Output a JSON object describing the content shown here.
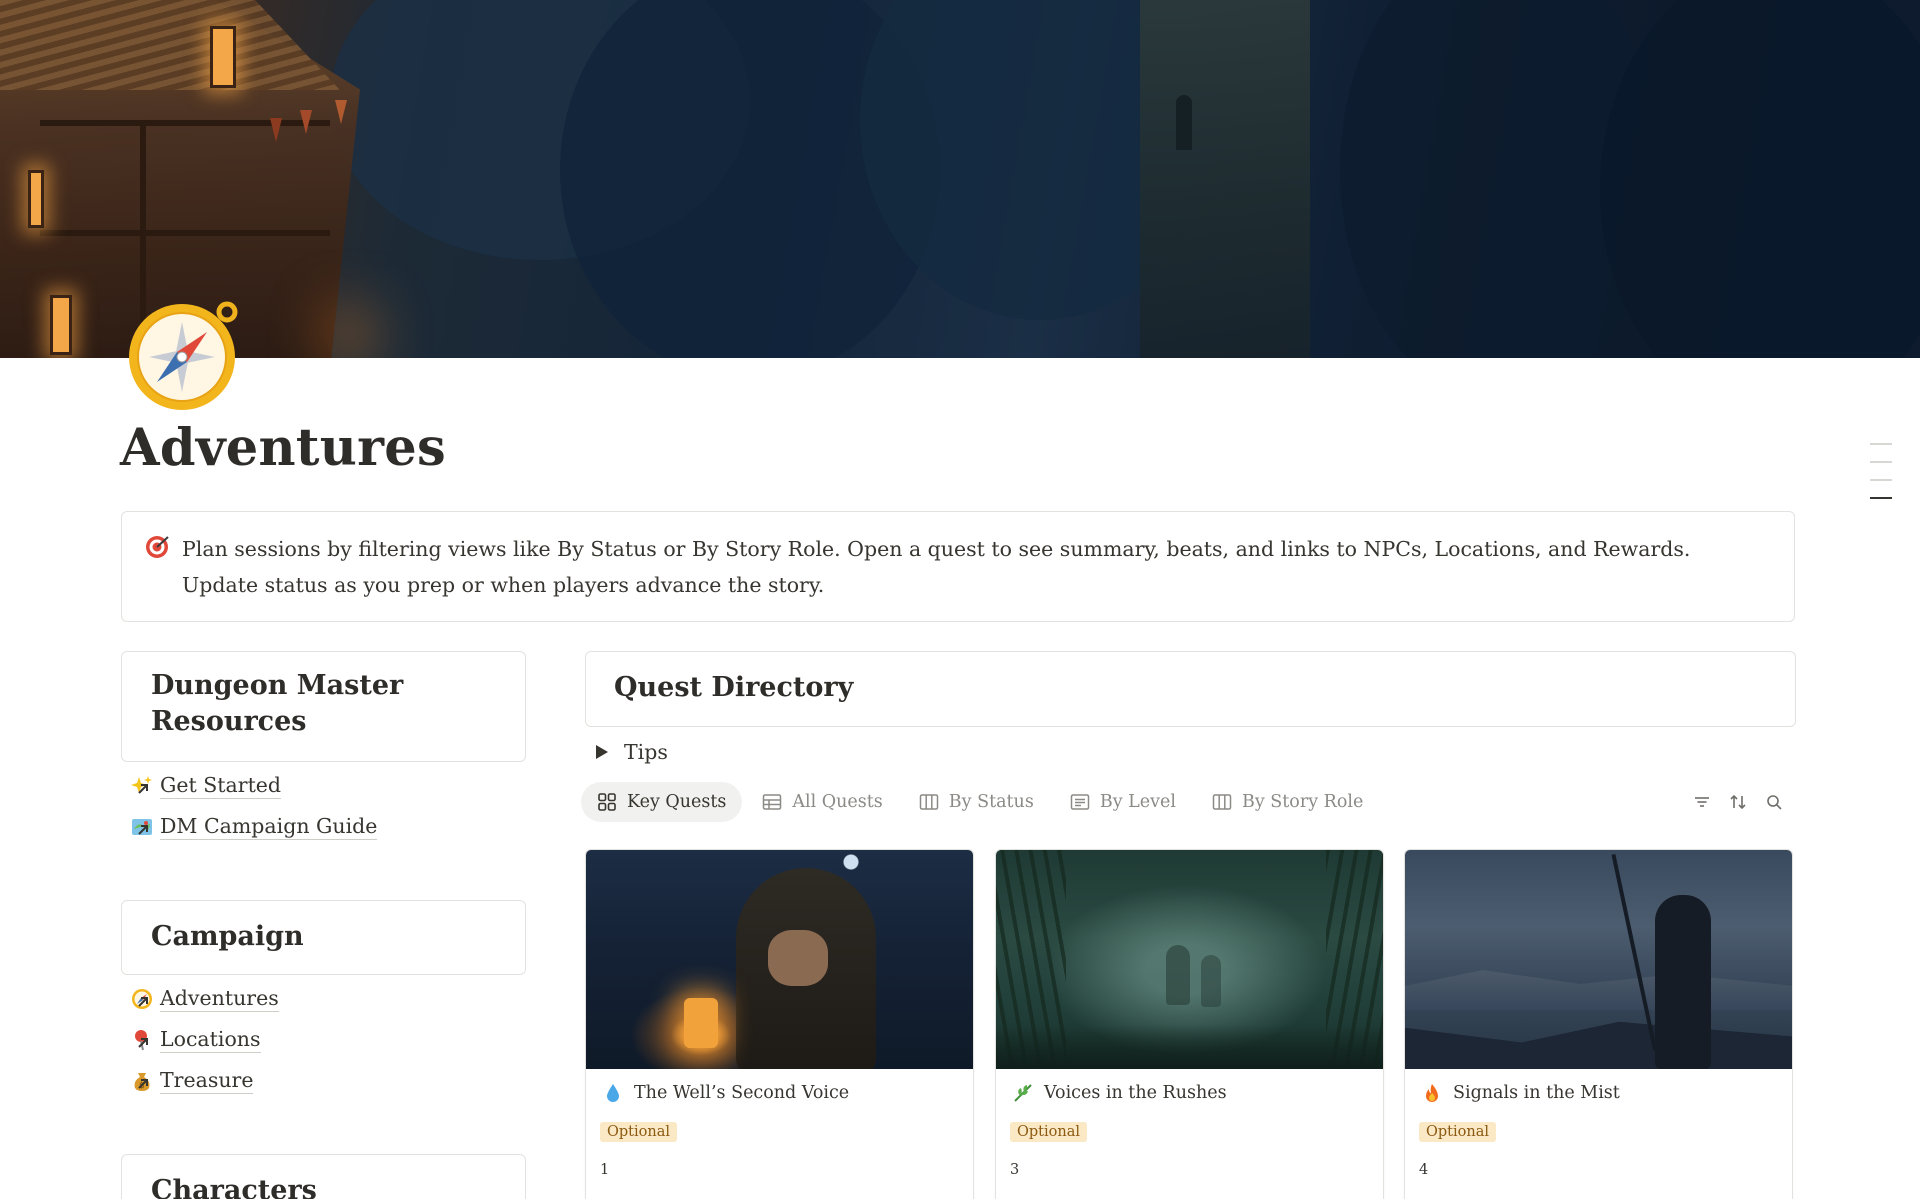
{
  "page": {
    "title": "Adventures",
    "icon": "compass-icon"
  },
  "callout": {
    "icon": "target-icon",
    "text": "Plan sessions by filtering views like By Status or By Story Role. Open a quest to see summary, beats, and links to NPCs, Locations, and Rewards. Update status as you prep or when players advance the story."
  },
  "sidebar": {
    "sections": [
      {
        "heading": "Dungeon Master Resources",
        "links": [
          {
            "label": "Get Started",
            "icon": "sparkles-icon"
          },
          {
            "label": "DM Campaign Guide",
            "icon": "map-icon"
          }
        ]
      },
      {
        "heading": "Campaign",
        "links": [
          {
            "label": "Adventures",
            "icon": "compass-icon"
          },
          {
            "label": "Locations",
            "icon": "pin-icon"
          },
          {
            "label": "Treasure",
            "icon": "money-bag-icon"
          }
        ]
      },
      {
        "heading": "Characters",
        "links": []
      }
    ]
  },
  "directory": {
    "heading": "Quest Directory",
    "toggle_label": "Tips",
    "tabs": [
      {
        "label": "Key Quests",
        "icon": "gallery-icon",
        "active": true
      },
      {
        "label": "All Quests",
        "icon": "table-icon",
        "active": false
      },
      {
        "label": "By Status",
        "icon": "board-icon",
        "active": false
      },
      {
        "label": "By Level",
        "icon": "list-icon",
        "active": false
      },
      {
        "label": "By Story Role",
        "icon": "board-icon",
        "active": false
      }
    ],
    "tools": [
      "filter-icon",
      "sort-icon",
      "search-icon"
    ],
    "cards": [
      {
        "title": "The Well’s Second Voice",
        "icon": "droplet-icon",
        "tag": "Optional",
        "number": "1"
      },
      {
        "title": "Voices in the Rushes",
        "icon": "herb-icon",
        "tag": "Optional",
        "number": "3"
      },
      {
        "title": "Signals in the Mist",
        "icon": "fire-icon",
        "tag": "Optional",
        "number": "4"
      }
    ]
  },
  "colors": {
    "tag_bg": "#fbe8c4",
    "tag_text": "#8a5a12",
    "border": "#e3e2df",
    "text": "#37352f"
  }
}
